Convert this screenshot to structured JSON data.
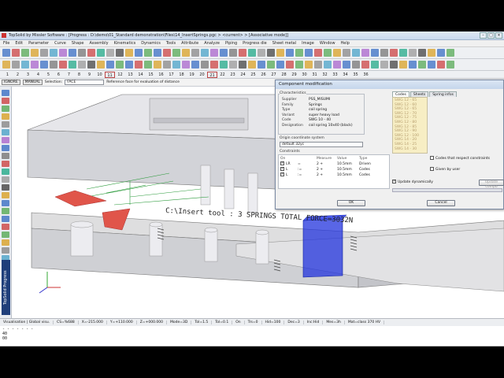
{
  "window": {
    "title": "TopSolid by Missler Software : [Progress : D:\\demo\\01_Standard demonstration\\Files\\14_InsertSprings.pgc > <current> > [Associative mode]]"
  },
  "menu": [
    "File",
    "Edit",
    "Parameter",
    "Curve",
    "Shape",
    "Assembly",
    "Kinematics",
    "Dynamics",
    "Tools",
    "Attribute",
    "Analyze",
    "Piping",
    "Progress die",
    "Sheet metal",
    "Image",
    "Window",
    "Help"
  ],
  "numbar": [
    "1",
    "2",
    "3",
    "4",
    "5",
    "6",
    "7",
    "8",
    "9",
    "10",
    "11",
    "12",
    "13",
    "14",
    "15",
    "16",
    "17",
    "18",
    "19",
    "20",
    "21",
    "22",
    "23",
    "24",
    "25",
    "26",
    "27",
    "28",
    "29",
    "30",
    "31",
    "32",
    "33",
    "34",
    "35",
    "36"
  ],
  "selection_bar": {
    "ignore": "IGNORE",
    "manual": "MANUAL",
    "selection_label": "Selection:",
    "selection_value": "FACE",
    "prompt": "Reference face for evaluation of distance"
  },
  "side_tab": "TopSolid Progress",
  "viewport": {
    "annotation": "C:\\Insert tool : 3 SPRINGS TOTAL FORCE=3032N"
  },
  "dialog": {
    "title": "Component modification",
    "characteristics_label": "Characteristics",
    "characteristics": [
      {
        "k": "Supplier",
        "v": "PSS_MISUMI"
      },
      {
        "k": "Family",
        "v": "Springs"
      },
      {
        "k": "Type",
        "v": "coil spring"
      },
      {
        "k": "Variant",
        "v": "super heavy load"
      },
      {
        "k": "Code",
        "v": "SWG 10 - 40"
      },
      {
        "k": "Designation",
        "v": "coil spring 10x40 (black)"
      }
    ],
    "origin_label": "Origin coordinate system",
    "origin_value": "default 32yc",
    "constraints_label": "Constraints",
    "constraints_headers": [
      "On",
      "",
      "",
      "Measure",
      "Value",
      "Type"
    ],
    "constraints": [
      {
        "on": "LR",
        "op": "=",
        "measure": "2 +",
        "value": "10.5mm",
        "type": "Driven"
      },
      {
        "on": "L",
        "op": ":=",
        "measure": "2 +",
        "value": "10.5mm",
        "type": "Codes"
      },
      {
        "on": "L",
        "op": ":=",
        "measure": "2 +",
        "value": "10.5mm",
        "type": "Codes"
      }
    ],
    "tabs": [
      "Codes",
      "Sheets",
      "Spring infos"
    ],
    "codes": [
      "SWG 12 - 65",
      "SWG 12 - 60",
      "SWG 12 - 65",
      "SWG 12 - 70",
      "SWG 12 - 75",
      "SWG 12 - 80",
      "SWG 12 - 85",
      "SWG 12 - 90",
      "SWG 12 - 100",
      "SWG 14 - 20",
      "SWG 14 - 25",
      "SWG 14 - 30"
    ],
    "codes_respect_label": "Codes that respect constraints",
    "given_by_user_label": "Given by user",
    "update_dyn_label": "Update dynamically",
    "update_comp_label": "Update compo",
    "ok_label": "OK",
    "cancel_label": "Cancel"
  },
  "status": [
    "Visualisation | Global visu.",
    "CS=%688",
    "X=-215.000",
    "Y=+110.000",
    "Z=+000.000",
    "Mode=3D",
    "Tol=1.5",
    "Tol=0.1",
    "On",
    "Trs=0",
    "Hid=100",
    "Dec=3",
    "Inc:Hid",
    "Mes=3h",
    "Mat=class 370 HV"
  ],
  "console": [
    "- - - - - - -",
    "40",
    "00"
  ],
  "colors": {
    "brand_tab": "#1f3e7a",
    "highlight_blue": "#2233dd",
    "cone_red": "#e0554a",
    "code_text": "#b8a070"
  }
}
